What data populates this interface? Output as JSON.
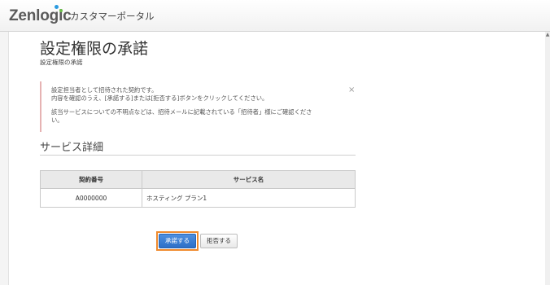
{
  "header": {
    "logo_text": "Zenlogic",
    "portal_title": "カスタマーポータル"
  },
  "page": {
    "title": "設定権限の承諾",
    "breadcrumb": "設定権限の承諾"
  },
  "notice": {
    "line1": "設定担当者として招待された契約です。",
    "line2": "内容を確認のうえ、[承諾する]または[拒否する]ボタンをクリックしてください。",
    "line3": "該当サービスについての不明点などは、招待メールに記載されている「招待者」様にご確認くださ",
    "line4": "い。",
    "close_symbol": "×"
  },
  "service_details": {
    "heading": "サービス詳細",
    "columns": [
      "契約番号",
      "サービス名"
    ],
    "rows": [
      [
        "A0000000",
        "ホスティング プラン1"
      ]
    ]
  },
  "actions": {
    "accept_label": "承諾する",
    "reject_label": "拒否する"
  },
  "colors": {
    "accept_button": "#2d6fc7",
    "highlight_border": "#f08a2c",
    "notice_border": "#e6b3b3"
  }
}
